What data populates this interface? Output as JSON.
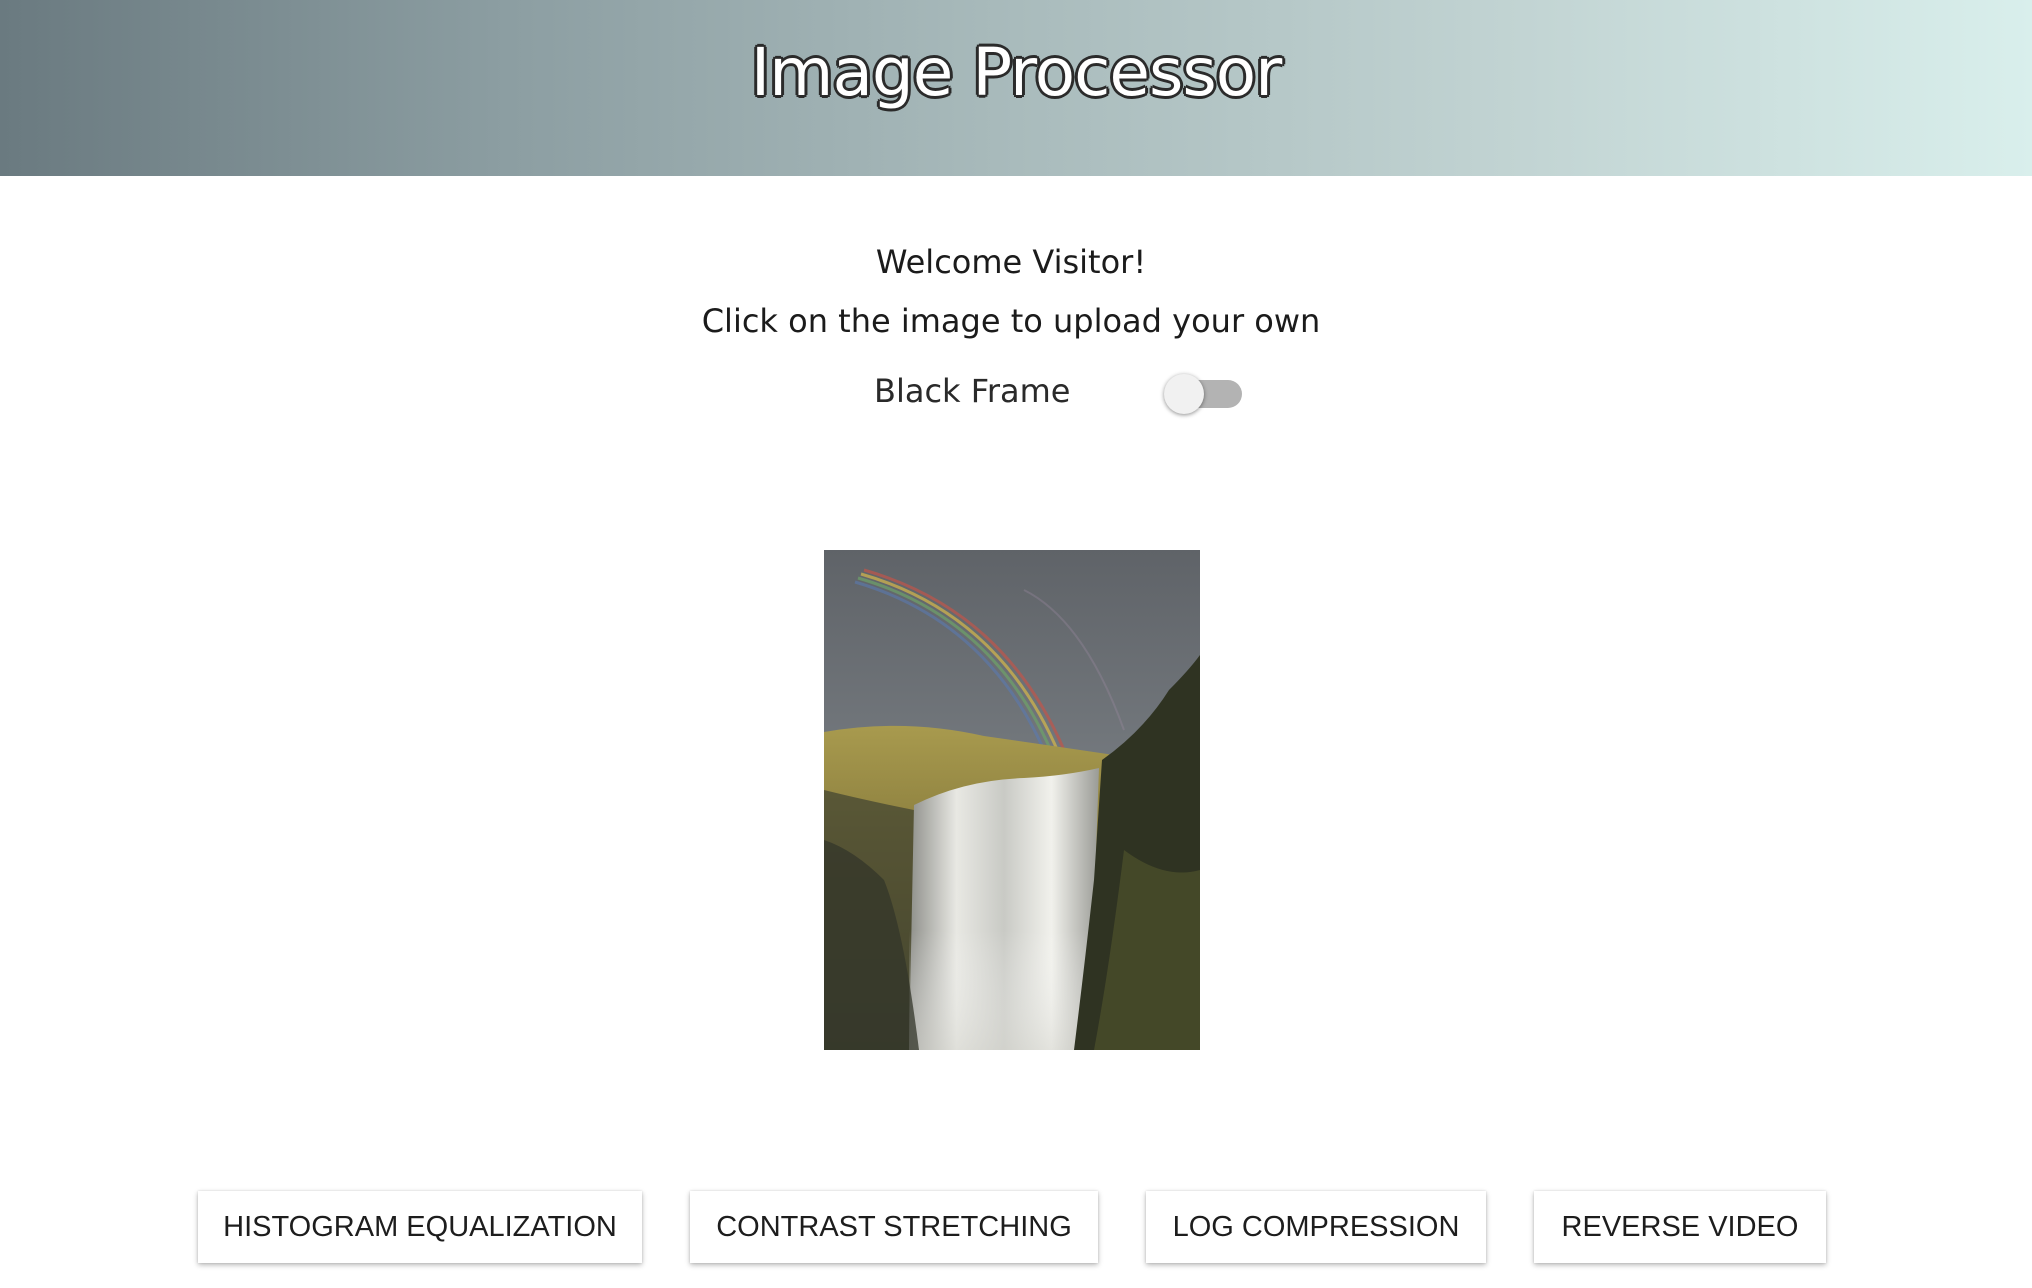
{
  "header": {
    "title": "Image Processor",
    "gradient_start": "#6a7a80",
    "gradient_end": "#d9efec"
  },
  "main": {
    "welcome": "Welcome Visitor!",
    "instruction": "Click on the image to upload your own",
    "black_frame": {
      "label": "Black Frame",
      "enabled": false
    },
    "image": {
      "icon": "waterfall-rainbow-photo"
    }
  },
  "actions": [
    {
      "label": "HISTOGRAM EQUALIZATION"
    },
    {
      "label": "CONTRAST STRETCHING"
    },
    {
      "label": "LOG COMPRESSION"
    },
    {
      "label": "REVERSE VIDEO"
    }
  ]
}
